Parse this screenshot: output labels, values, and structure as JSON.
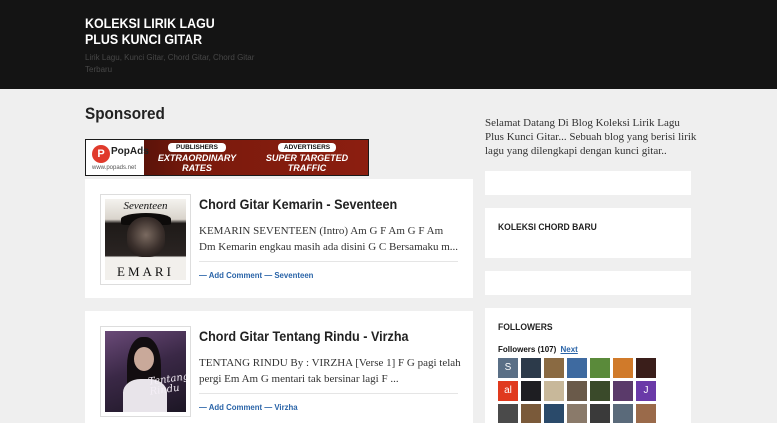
{
  "header": {
    "title": "KOLEKSI LIRIK LAGU PLUS KUNCI GITAR",
    "description": "Lirik Lagu, Kunci Gitar, Chord Gitar, Chord Gitar Terbaru",
    "background_color": "#141414"
  },
  "sponsored": {
    "heading": "Sponsored",
    "ad": {
      "logo_letter": "P",
      "logo_text": "PopAds",
      "logo_url": "www.popads.net",
      "pill_left": "PUBLISHERS",
      "pill_right": "ADVERTISERS",
      "line_left_1": "EXTRAORDINARY",
      "line_left_2": "RATES",
      "line_right_1": "SUPER TARGETED",
      "line_right_2": "TRAFFIC"
    }
  },
  "posts": [
    {
      "title": "Chord Gitar Kemarin - Seventeen",
      "snippet": "KEMARIN SEVENTEEN (Intro) Am G F Am G F Am Dm Kemarin engkau masih ada disini G C Bersamaku m...",
      "comment_label": "Add Comment",
      "label": "Seventeen",
      "thumb_title": "Seventeen",
      "thumb_bottom": "EMARI"
    },
    {
      "title": "Chord Gitar Tentang Rindu - Virzha",
      "snippet": "TENTANG RINDU By : VIRZHA [Verse 1] F G pagi telah pergi Em Am G mentari tak bersinar lagi F ...",
      "comment_label": "Add Comment",
      "label": "Virzha",
      "thumb_script": "Tentang Rindu"
    }
  ],
  "sidebar": {
    "welcome": "Selamat Datang Di Blog Koleksi Lirik Lagu Plus Kunci Gitar... Sebuah blog yang berisi lirik lagu yang dilengkapi dengan kunci gitar..",
    "koleksi_title": "KOLEKSI CHORD BARU",
    "followers_title": "FOLLOWERS",
    "followers_label": "Followers",
    "followers_count": "(107)",
    "followers_next": "Next",
    "avatars": [
      {
        "letter": "S",
        "color": "#5a6f86"
      },
      {
        "letter": "",
        "color": "#2c3a4a"
      },
      {
        "letter": "",
        "color": "#8a6a42"
      },
      {
        "letter": "",
        "color": "#3e6aa0"
      },
      {
        "letter": "",
        "color": "#5a8a3a"
      },
      {
        "letter": "",
        "color": "#d07a2a"
      },
      {
        "letter": "",
        "color": "#3a1e1a"
      },
      {
        "letter": "al",
        "color": "#e03a1e"
      },
      {
        "letter": "",
        "color": "#1e1e22"
      },
      {
        "letter": "",
        "color": "#c8b89a"
      },
      {
        "letter": "",
        "color": "#6a5a4a"
      },
      {
        "letter": "",
        "color": "#3a4a2a"
      },
      {
        "letter": "",
        "color": "#5a3a6a"
      },
      {
        "letter": "J",
        "color": "#6a3aa8"
      },
      {
        "letter": "",
        "color": "#4a4a4a"
      },
      {
        "letter": "",
        "color": "#7a5a3a"
      },
      {
        "letter": "",
        "color": "#2a4a6a"
      },
      {
        "letter": "",
        "color": "#8a7a6a"
      },
      {
        "letter": "",
        "color": "#3a3a3a"
      },
      {
        "letter": "",
        "color": "#5a6a7a"
      },
      {
        "letter": "",
        "color": "#9a6a4a"
      }
    ]
  }
}
